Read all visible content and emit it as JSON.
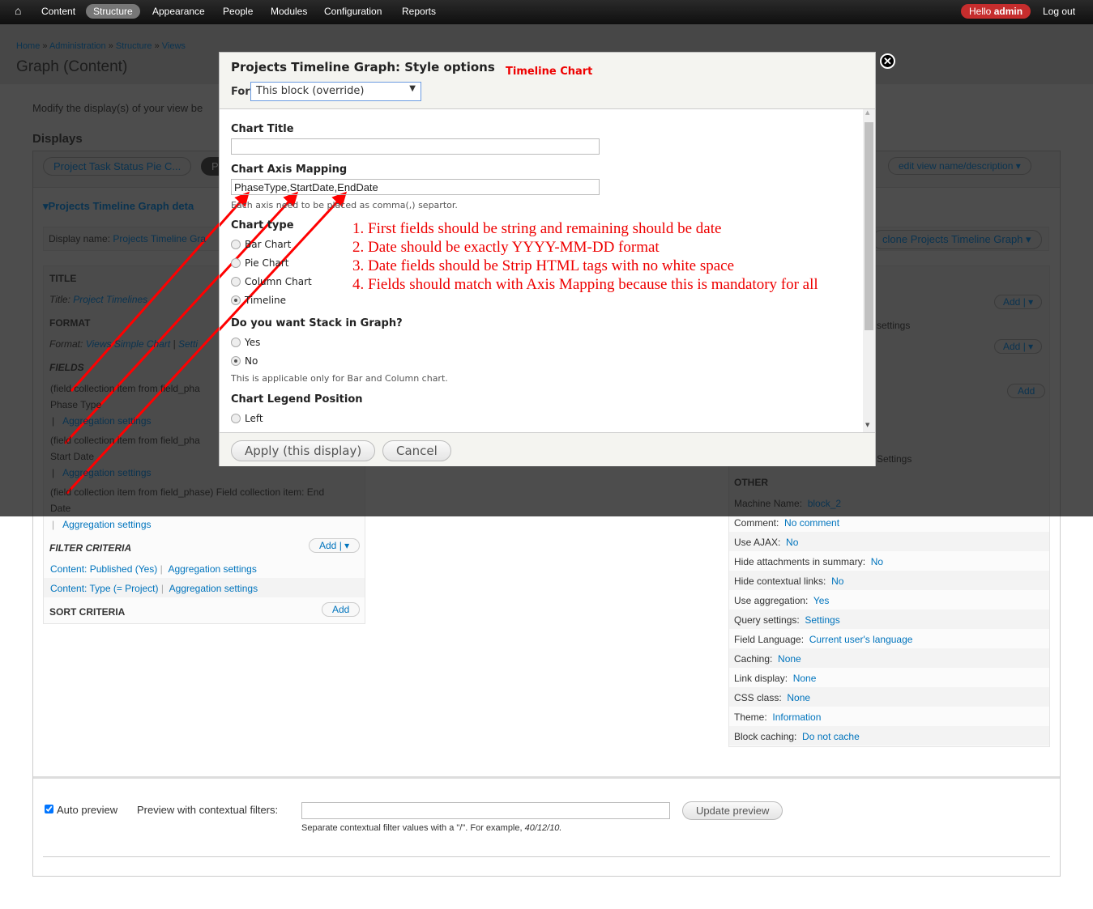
{
  "toolbar": {
    "items": [
      "Content",
      "Structure",
      "Appearance",
      "People",
      "Modules",
      "Configuration",
      "Reports"
    ],
    "hello": "Hello",
    "user": "admin",
    "logout": "Log out"
  },
  "breadcrumb": [
    "Home",
    "Administration",
    "Structure",
    "Views"
  ],
  "page_title": "Graph (Content)",
  "intro": "Modify the display(s) of your view be",
  "displays_heading": "Displays",
  "display_tabs": [
    "Project Task Status Pie C...",
    "Pr"
  ],
  "edit_view": "edit view name/description",
  "details_heading": "Projects Timeline Graph deta",
  "display_name_label": "Display name:",
  "display_name_value": "Projects Timeline Gra",
  "clone": "clone Projects Timeline Graph",
  "left": {
    "title_h": "TITLE",
    "title_label": "Title:",
    "title_value": "Project Timelines",
    "format_h": "FORMAT",
    "format_label": "Format:",
    "format_value": "Views Simple Chart",
    "format_settings": "Setti",
    "fields_h": "FIELDS",
    "fields": [
      {
        "l1": "(field collection item from field_pha",
        "l2": "Phase Type",
        "agg": "Aggregation settings"
      },
      {
        "l1": "(field collection item from field_pha",
        "l2": "Start Date",
        "agg": "Aggregation settings"
      },
      {
        "l1": "(field collection item from field_phase) Field collection item: End",
        "l2": "Date",
        "agg": "Aggregation settings"
      }
    ],
    "filter_h": "FILTER CRITERIA",
    "add": "Add",
    "filters": [
      {
        "label": "Content: Published (Yes)",
        "agg": "Aggregation settings"
      },
      {
        "label": "Content: Type (= Project)",
        "agg": "Aggregation settings"
      }
    ],
    "sort_h": "SORT CRITERIA"
  },
  "right": {
    "settings1": "settings",
    "settings2": "Settings",
    "other_h": "OTHER",
    "rows": [
      [
        "Machine Name:",
        "block_2"
      ],
      [
        "Comment:",
        "No comment"
      ],
      [
        "Use AJAX:",
        "No"
      ],
      [
        "Hide attachments in summary:",
        "No"
      ],
      [
        "Hide contextual links:",
        "No"
      ],
      [
        "Use aggregation:",
        "Yes"
      ],
      [
        "Query settings:",
        "Settings"
      ],
      [
        "Field Language:",
        "Current user's language"
      ],
      [
        "Caching:",
        "None"
      ],
      [
        "Link display:",
        "None"
      ],
      [
        "CSS class:",
        "None"
      ],
      [
        "Theme:",
        "Information"
      ],
      [
        "Block caching:",
        "Do not cache"
      ]
    ]
  },
  "preview": {
    "auto": "Auto preview",
    "auto_checked": true,
    "ctx_label": "Preview with contextual filters:",
    "ctx_value": "",
    "update": "Update preview",
    "help": "Separate contextual filter values with a \"/\". For example, ",
    "example": "40/12/10."
  },
  "modal": {
    "title": "Projects Timeline Graph: Style options",
    "annotation": "Timeline Chart",
    "for_label": "For",
    "for_value": "This block (override)",
    "chart_title_label": "Chart Title",
    "chart_title_value": "",
    "axis_label": "Chart Axis Mapping",
    "axis_value": "PhaseType,StartDate,EndDate",
    "axis_help": "Each axis need to be placed as comma(,) separtor.",
    "type_label": "Chart type",
    "types": [
      "Bar Chart",
      "Pie Chart",
      "Column Chart",
      "Timeline"
    ],
    "type_selected": "Timeline",
    "stack_label": "Do you want Stack in Graph?",
    "stack_opts": [
      "Yes",
      "No"
    ],
    "stack_selected": "No",
    "stack_help": "This is applicable only for Bar and Column chart.",
    "legend_label": "Chart Legend Position",
    "legend_opts": [
      "Left"
    ],
    "apply": "Apply (this display)",
    "cancel": "Cancel",
    "notes": [
      "1. First fields should be string and remaining should be date",
      "2. Date should be exactly YYYY-MM-DD format",
      "3. Date fields should be Strip HTML tags with no white space",
      "4. Fields should match with Axis Mapping because this is mandatory for all"
    ]
  },
  "colors": {
    "annotation": "#ff0000",
    "link": "#0074bd",
    "toolbar_active": "#777777",
    "hello": "#c62d2d"
  }
}
